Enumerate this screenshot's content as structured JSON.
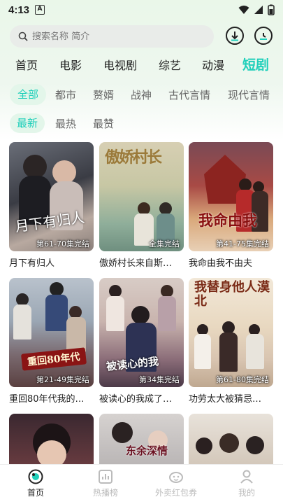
{
  "status": {
    "time": "4:13",
    "app_indicator": "A"
  },
  "search": {
    "placeholder": "搜索名称 简介"
  },
  "main_tabs": [
    {
      "label": "首页"
    },
    {
      "label": "电影"
    },
    {
      "label": "电视剧"
    },
    {
      "label": "综艺"
    },
    {
      "label": "动漫"
    },
    {
      "label": "短剧",
      "active": true
    }
  ],
  "categories": [
    {
      "label": "全部",
      "active": true
    },
    {
      "label": "都市"
    },
    {
      "label": "赘婿"
    },
    {
      "label": "战神"
    },
    {
      "label": "古代言情"
    },
    {
      "label": "现代言情"
    }
  ],
  "sort": [
    {
      "label": "最新",
      "active": true
    },
    {
      "label": "最热"
    },
    {
      "label": "最赞"
    }
  ],
  "items": [
    {
      "title": "月下有归人",
      "badge": "第61-70集完结",
      "poster_text": "月下有归人"
    },
    {
      "title": "傲娇村长来自斯…",
      "badge": "全集完结",
      "poster_text": "傲娇村长"
    },
    {
      "title": "我命由我不由夫",
      "badge": "第41-75集完结",
      "poster_text": "我命由我"
    },
    {
      "title": "重回80年代我的…",
      "badge": "第21-49集完结",
      "poster_text": "重回80年代"
    },
    {
      "title": "被读心的我成了…",
      "badge": "第34集完结",
      "poster_text": "被读心的我"
    },
    {
      "title": "功劳太大被猜忌…",
      "badge": "第61-80集完结",
      "poster_text": "我替身他人漠北"
    },
    {
      "title": "",
      "badge": "",
      "poster_text": ""
    },
    {
      "title": "",
      "badge": "",
      "poster_text": "东余深情"
    },
    {
      "title": "",
      "badge": "",
      "poster_text": ""
    }
  ],
  "tabbar": [
    {
      "label": "首页",
      "icon": "home-icon",
      "active": true
    },
    {
      "label": "热播榜",
      "icon": "chart-icon"
    },
    {
      "label": "外卖红包券",
      "icon": "coupon-icon"
    },
    {
      "label": "我的",
      "icon": "user-icon"
    }
  ],
  "colors": {
    "accent": "#1fcfba",
    "accent_bg": "#e3f6ea"
  }
}
